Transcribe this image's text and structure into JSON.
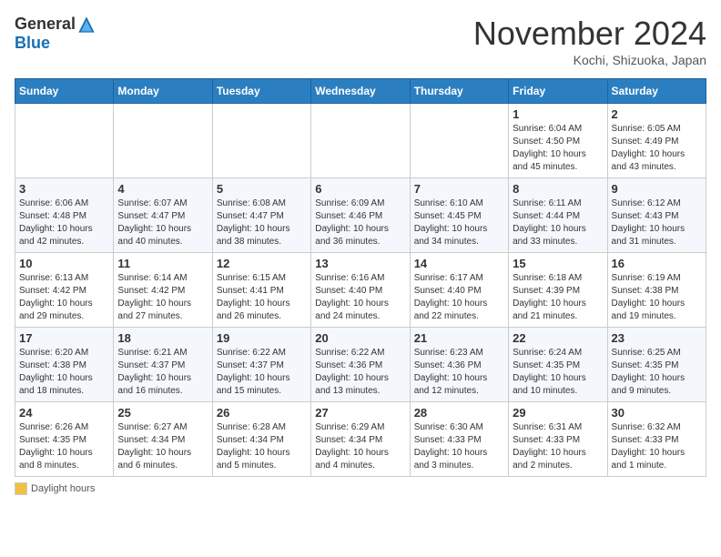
{
  "logo": {
    "general": "General",
    "blue": "Blue"
  },
  "header": {
    "month": "November 2024",
    "location": "Kochi, Shizuoka, Japan"
  },
  "weekdays": [
    "Sunday",
    "Monday",
    "Tuesday",
    "Wednesday",
    "Thursday",
    "Friday",
    "Saturday"
  ],
  "weeks": [
    [
      {
        "day": "",
        "info": ""
      },
      {
        "day": "",
        "info": ""
      },
      {
        "day": "",
        "info": ""
      },
      {
        "day": "",
        "info": ""
      },
      {
        "day": "",
        "info": ""
      },
      {
        "day": "1",
        "info": "Sunrise: 6:04 AM\nSunset: 4:50 PM\nDaylight: 10 hours and 45 minutes."
      },
      {
        "day": "2",
        "info": "Sunrise: 6:05 AM\nSunset: 4:49 PM\nDaylight: 10 hours and 43 minutes."
      }
    ],
    [
      {
        "day": "3",
        "info": "Sunrise: 6:06 AM\nSunset: 4:48 PM\nDaylight: 10 hours and 42 minutes."
      },
      {
        "day": "4",
        "info": "Sunrise: 6:07 AM\nSunset: 4:47 PM\nDaylight: 10 hours and 40 minutes."
      },
      {
        "day": "5",
        "info": "Sunrise: 6:08 AM\nSunset: 4:47 PM\nDaylight: 10 hours and 38 minutes."
      },
      {
        "day": "6",
        "info": "Sunrise: 6:09 AM\nSunset: 4:46 PM\nDaylight: 10 hours and 36 minutes."
      },
      {
        "day": "7",
        "info": "Sunrise: 6:10 AM\nSunset: 4:45 PM\nDaylight: 10 hours and 34 minutes."
      },
      {
        "day": "8",
        "info": "Sunrise: 6:11 AM\nSunset: 4:44 PM\nDaylight: 10 hours and 33 minutes."
      },
      {
        "day": "9",
        "info": "Sunrise: 6:12 AM\nSunset: 4:43 PM\nDaylight: 10 hours and 31 minutes."
      }
    ],
    [
      {
        "day": "10",
        "info": "Sunrise: 6:13 AM\nSunset: 4:42 PM\nDaylight: 10 hours and 29 minutes."
      },
      {
        "day": "11",
        "info": "Sunrise: 6:14 AM\nSunset: 4:42 PM\nDaylight: 10 hours and 27 minutes."
      },
      {
        "day": "12",
        "info": "Sunrise: 6:15 AM\nSunset: 4:41 PM\nDaylight: 10 hours and 26 minutes."
      },
      {
        "day": "13",
        "info": "Sunrise: 6:16 AM\nSunset: 4:40 PM\nDaylight: 10 hours and 24 minutes."
      },
      {
        "day": "14",
        "info": "Sunrise: 6:17 AM\nSunset: 4:40 PM\nDaylight: 10 hours and 22 minutes."
      },
      {
        "day": "15",
        "info": "Sunrise: 6:18 AM\nSunset: 4:39 PM\nDaylight: 10 hours and 21 minutes."
      },
      {
        "day": "16",
        "info": "Sunrise: 6:19 AM\nSunset: 4:38 PM\nDaylight: 10 hours and 19 minutes."
      }
    ],
    [
      {
        "day": "17",
        "info": "Sunrise: 6:20 AM\nSunset: 4:38 PM\nDaylight: 10 hours and 18 minutes."
      },
      {
        "day": "18",
        "info": "Sunrise: 6:21 AM\nSunset: 4:37 PM\nDaylight: 10 hours and 16 minutes."
      },
      {
        "day": "19",
        "info": "Sunrise: 6:22 AM\nSunset: 4:37 PM\nDaylight: 10 hours and 15 minutes."
      },
      {
        "day": "20",
        "info": "Sunrise: 6:22 AM\nSunset: 4:36 PM\nDaylight: 10 hours and 13 minutes."
      },
      {
        "day": "21",
        "info": "Sunrise: 6:23 AM\nSunset: 4:36 PM\nDaylight: 10 hours and 12 minutes."
      },
      {
        "day": "22",
        "info": "Sunrise: 6:24 AM\nSunset: 4:35 PM\nDaylight: 10 hours and 10 minutes."
      },
      {
        "day": "23",
        "info": "Sunrise: 6:25 AM\nSunset: 4:35 PM\nDaylight: 10 hours and 9 minutes."
      }
    ],
    [
      {
        "day": "24",
        "info": "Sunrise: 6:26 AM\nSunset: 4:35 PM\nDaylight: 10 hours and 8 minutes."
      },
      {
        "day": "25",
        "info": "Sunrise: 6:27 AM\nSunset: 4:34 PM\nDaylight: 10 hours and 6 minutes."
      },
      {
        "day": "26",
        "info": "Sunrise: 6:28 AM\nSunset: 4:34 PM\nDaylight: 10 hours and 5 minutes."
      },
      {
        "day": "27",
        "info": "Sunrise: 6:29 AM\nSunset: 4:34 PM\nDaylight: 10 hours and 4 minutes."
      },
      {
        "day": "28",
        "info": "Sunrise: 6:30 AM\nSunset: 4:33 PM\nDaylight: 10 hours and 3 minutes."
      },
      {
        "day": "29",
        "info": "Sunrise: 6:31 AM\nSunset: 4:33 PM\nDaylight: 10 hours and 2 minutes."
      },
      {
        "day": "30",
        "info": "Sunrise: 6:32 AM\nSunset: 4:33 PM\nDaylight: 10 hours and 1 minute."
      }
    ]
  ],
  "legend": {
    "label": "Daylight hours"
  }
}
